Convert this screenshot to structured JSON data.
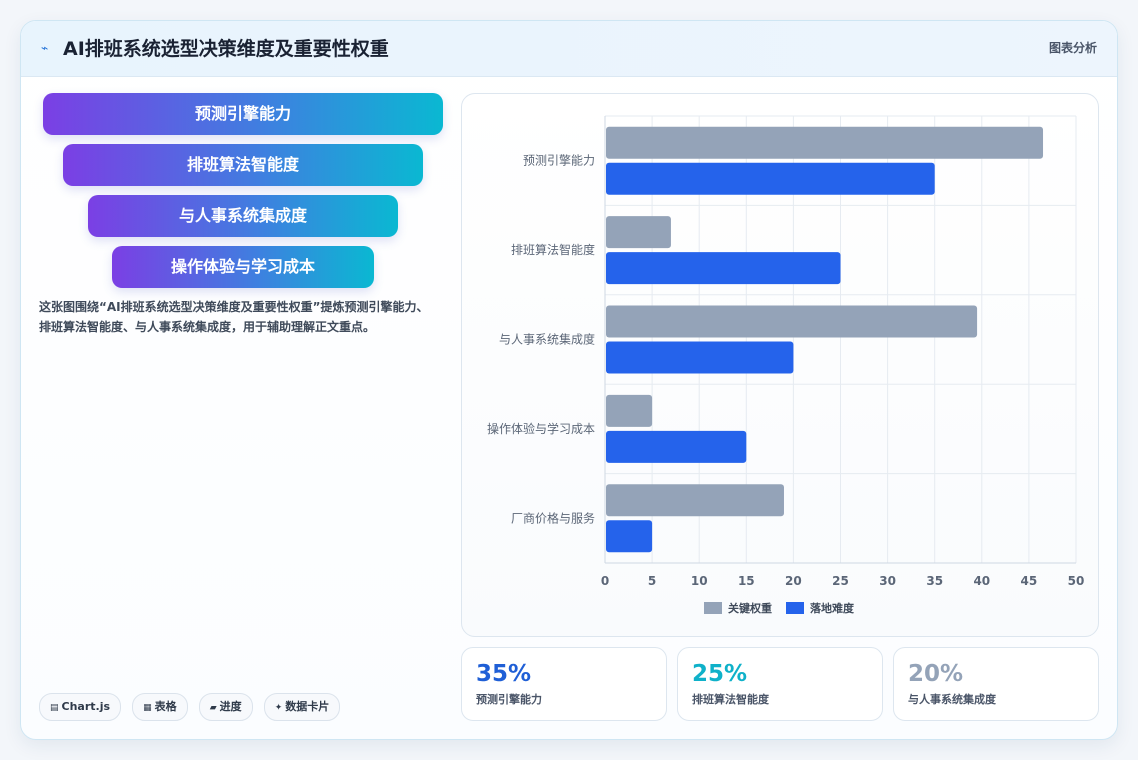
{
  "header": {
    "icon": "chart-trend-icon",
    "title": "AI排班系统选型决策维度及重要性权重",
    "tag": "图表分析"
  },
  "funnel": {
    "steps": [
      {
        "label": "预测引擎能力"
      },
      {
        "label": "排班算法智能度"
      },
      {
        "label": "与人事系统集成度"
      },
      {
        "label": "操作体验与学习成本"
      }
    ]
  },
  "description": "这张图围绕“AI排班系统选型决策维度及重要性权重”提炼预测引擎能力、排班算法智能度、与人事系统集成度，用于辅助理解正文重点。",
  "chips": [
    {
      "icon": "chart-icon",
      "label": "Chart.js"
    },
    {
      "icon": "table-icon",
      "label": "表格"
    },
    {
      "icon": "progress-icon",
      "label": "进度"
    },
    {
      "icon": "sparkle-icon",
      "label": "数据卡片"
    }
  ],
  "stats": [
    {
      "value": "35%",
      "label": "预测引擎能力",
      "color": "#1f5fd6"
    },
    {
      "value": "25%",
      "label": "排班算法智能度",
      "color": "#0fb1c9"
    },
    {
      "value": "20%",
      "label": "与人事系统集成度",
      "color": "#94a3b8"
    }
  ],
  "chart_data": {
    "type": "bar",
    "orientation": "horizontal",
    "categories": [
      "预测引擎能力",
      "排班算法智能度",
      "与人事系统集成度",
      "操作体验与学习成本",
      "厂商价格与服务"
    ],
    "series": [
      {
        "name": "关键权重",
        "color": "#94a3b8",
        "values": [
          46.5,
          7,
          39.5,
          5,
          19
        ]
      },
      {
        "name": "落地难度",
        "color": "#2563eb",
        "values": [
          35,
          25,
          20,
          15,
          5
        ]
      }
    ],
    "xlim": [
      0,
      50
    ],
    "xticks": [
      0,
      5,
      10,
      15,
      20,
      25,
      30,
      35,
      40,
      45,
      50
    ],
    "grid": true,
    "legend": "bottom"
  }
}
